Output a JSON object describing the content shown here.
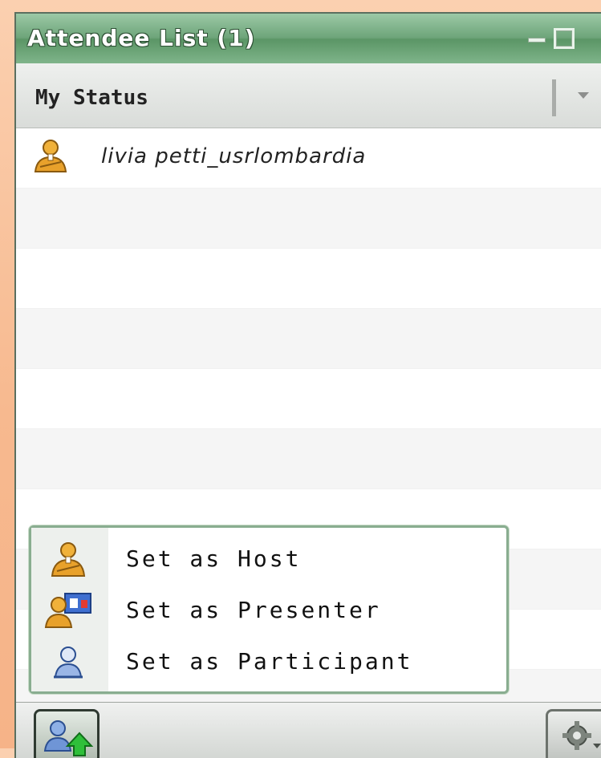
{
  "window": {
    "title": "Attendee List (1)",
    "controls": [
      "minimize",
      "maximize"
    ]
  },
  "status": {
    "label": "My Status",
    "dropdown_icon": "chevron-down-icon"
  },
  "attendees": [
    {
      "name": "livia petti_usrlombardia",
      "role_icon": "host-icon"
    }
  ],
  "context_menu": {
    "items": [
      {
        "label": "Set as Host",
        "icon": "host-icon"
      },
      {
        "label": "Set as Presenter",
        "icon": "presenter-icon"
      },
      {
        "label": "Set as Participant",
        "icon": "participant-icon"
      }
    ]
  },
  "footer": {
    "role_button_icon": "change-role-icon",
    "settings_button_icon": "gear-icon"
  },
  "colors": {
    "titlebar_green": "#6ea57a",
    "menu_border": "#89ad90",
    "host_orange": "#e8a12b",
    "participant_blue": "#4b78c6"
  }
}
